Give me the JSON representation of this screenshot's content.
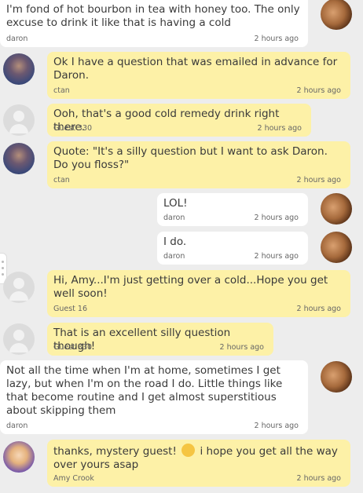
{
  "messages": [
    {
      "text": "I'm fond of hot bourbon in tea with honey too. The only excuse to drink it like that is having a cold",
      "author": "daron",
      "time": "2 hours ago"
    },
    {
      "text": "Ok I have a question that was emailed in advance for Daron.",
      "author": "ctan",
      "time": "2 hours ago"
    },
    {
      "text": "Ooh, that's a good cold remedy drink right there.",
      "author": "Guest 330",
      "time": "2 hours ago"
    },
    {
      "text": "Quote: \"It's a silly question but I want to ask Daron. Do you floss?\"",
      "author": "ctan",
      "time": "2 hours ago"
    },
    {
      "text": "LOL!",
      "author": "daron",
      "time": "2 hours ago"
    },
    {
      "text": "I do.",
      "author": "daron",
      "time": "2 hours ago"
    },
    {
      "text": "Hi, Amy...I'm just getting over a cold...Hope you get well soon!",
      "author": "Guest 16",
      "time": "2 hours ago"
    },
    {
      "text": "That is an excellent silly question though!",
      "author": "Guest 330",
      "time": "2 hours ago"
    },
    {
      "text": "Not all the time when I'm at home, sometimes I get lazy, but when I'm on the road I do. Little things like that become routine and I get almost superstitious about skipping them",
      "author": "daron",
      "time": "2 hours ago"
    },
    {
      "text_before": "thanks, mystery guest!",
      "emoji": "relieved-face",
      "text_after": "i hope you get all the way over yours asap",
      "author": "Amy Crook",
      "time": "2 hours ago"
    }
  ]
}
